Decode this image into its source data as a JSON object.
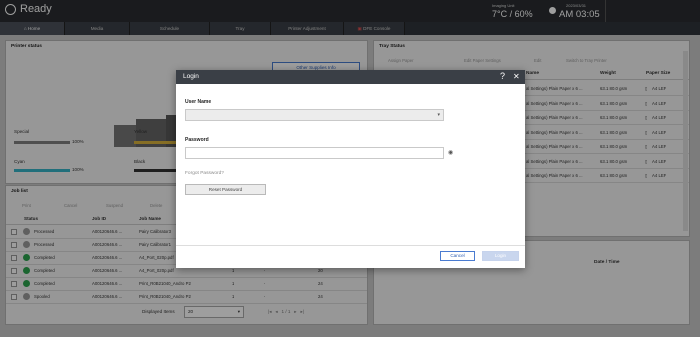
{
  "status": {
    "ready_label": "Ready",
    "imaging_unit_label": "Imaging Unit",
    "temp_humidity": "7°C / 60%",
    "date": "2023/03/31",
    "time": "AM 03:05",
    "user": "GUEST"
  },
  "tabs": [
    {
      "label": "Home"
    },
    {
      "label": "Media"
    },
    {
      "label": "Schedule"
    },
    {
      "label": "Tray"
    },
    {
      "label": "Printer Adjustment"
    },
    {
      "label": "DFE Console"
    }
  ],
  "printer_status": {
    "title": "Printer status",
    "supplies_button": "Other Supplies Info",
    "toners": [
      {
        "name": "Special",
        "pct": "100%",
        "level": 1.0,
        "color": "#808080"
      },
      {
        "name": "Yellow",
        "pct": "",
        "level": 1.0,
        "color": "#d8b23c"
      },
      {
        "name": "Cyan",
        "pct": "100%",
        "level": 1.0,
        "color": "#36b3c7"
      },
      {
        "name": "Black",
        "pct": "",
        "level": 1.0,
        "color": "#333333"
      }
    ]
  },
  "job_list": {
    "title": "Job list",
    "toolbar": [
      "Print",
      "Cancel",
      "Suspend",
      "Delete"
    ],
    "columns": [
      "Status",
      "Job ID",
      "Job Name"
    ],
    "rows": [
      {
        "status": "Processed",
        "id": "A00120646.6 ...",
        "name": "Pairy Calibrator3",
        "icon": "gray",
        "c3": "",
        "c4": "",
        "c5": ""
      },
      {
        "status": "Processed",
        "id": "A00120646.6 ...",
        "name": "Pairy Calibrator1",
        "icon": "gray",
        "c3": "",
        "c4": "",
        "c5": ""
      },
      {
        "status": "Completed",
        "id": "A00120646.6 ...",
        "name": "A4_Port_020p.pdf",
        "icon": "green",
        "c3": "",
        "c4": "",
        "c5": ""
      },
      {
        "status": "Completed",
        "id": "A00120646.6 ...",
        "name": "A4_Port_020p.pdf",
        "icon": "green",
        "c3": "1",
        "c4": "-",
        "c5": "20"
      },
      {
        "status": "Completed",
        "id": "A00120646.6 ...",
        "name": "Print_R0B21040_Andro P2",
        "icon": "green",
        "c3": "1",
        "c4": "-",
        "c5": "24"
      },
      {
        "status": "Spooled",
        "id": "A00120646.6 ...",
        "name": "Print_R0B21040_Andro P2",
        "icon": "gray",
        "c3": "1",
        "c4": "-",
        "c5": "24"
      }
    ],
    "displayed_label": "Displayed Items",
    "displayed_value": "20",
    "pager": "1 / 1"
  },
  "tray_status": {
    "title": "Tray Status",
    "toolbar": [
      "Assign Paper",
      "Edit Paper Settings",
      "Edit",
      "Switch to Tray Printer"
    ],
    "columns": [
      "Name",
      "Weight",
      "Paper Size"
    ],
    "rows": [
      {
        "name": "al Settings) Plain Paper x 6 ...",
        "weight": "63.1 80.0 gsm",
        "size": "A4 LEF"
      },
      {
        "name": "al Settings) Plain Paper x 6 ...",
        "weight": "63.1 80.0 gsm",
        "size": "A4 LEF"
      },
      {
        "name": "al Settings) Plain Paper x 6 ...",
        "weight": "63.1 80.0 gsm",
        "size": "A4 LEF"
      },
      {
        "name": "al Settings) Plain Paper x 6 ...",
        "weight": "63.1 80.0 gsm",
        "size": "A4 LEF"
      },
      {
        "name": "al Settings) Plain Paper x 6 ...",
        "weight": "63.1 80.0 gsm",
        "size": "A4 LEF"
      },
      {
        "name": "al Settings) Plain Paper x 6 ...",
        "weight": "63.1 80.0 gsm",
        "size": "A4 LEF"
      },
      {
        "name": "al Settings) Plain Paper x 6 ...",
        "weight": "63.1 80.0 gsm",
        "size": "A4 LEF"
      }
    ],
    "history_header": "Date / Time"
  },
  "login": {
    "title": "Login",
    "help_glyph": "?",
    "close_glyph": "✕",
    "username_label": "User Name",
    "password_label": "Password",
    "forgot_label": "Forgot Password?",
    "reset_button": "Reset Password",
    "cancel_button": "Cancel",
    "login_button": "Login"
  }
}
